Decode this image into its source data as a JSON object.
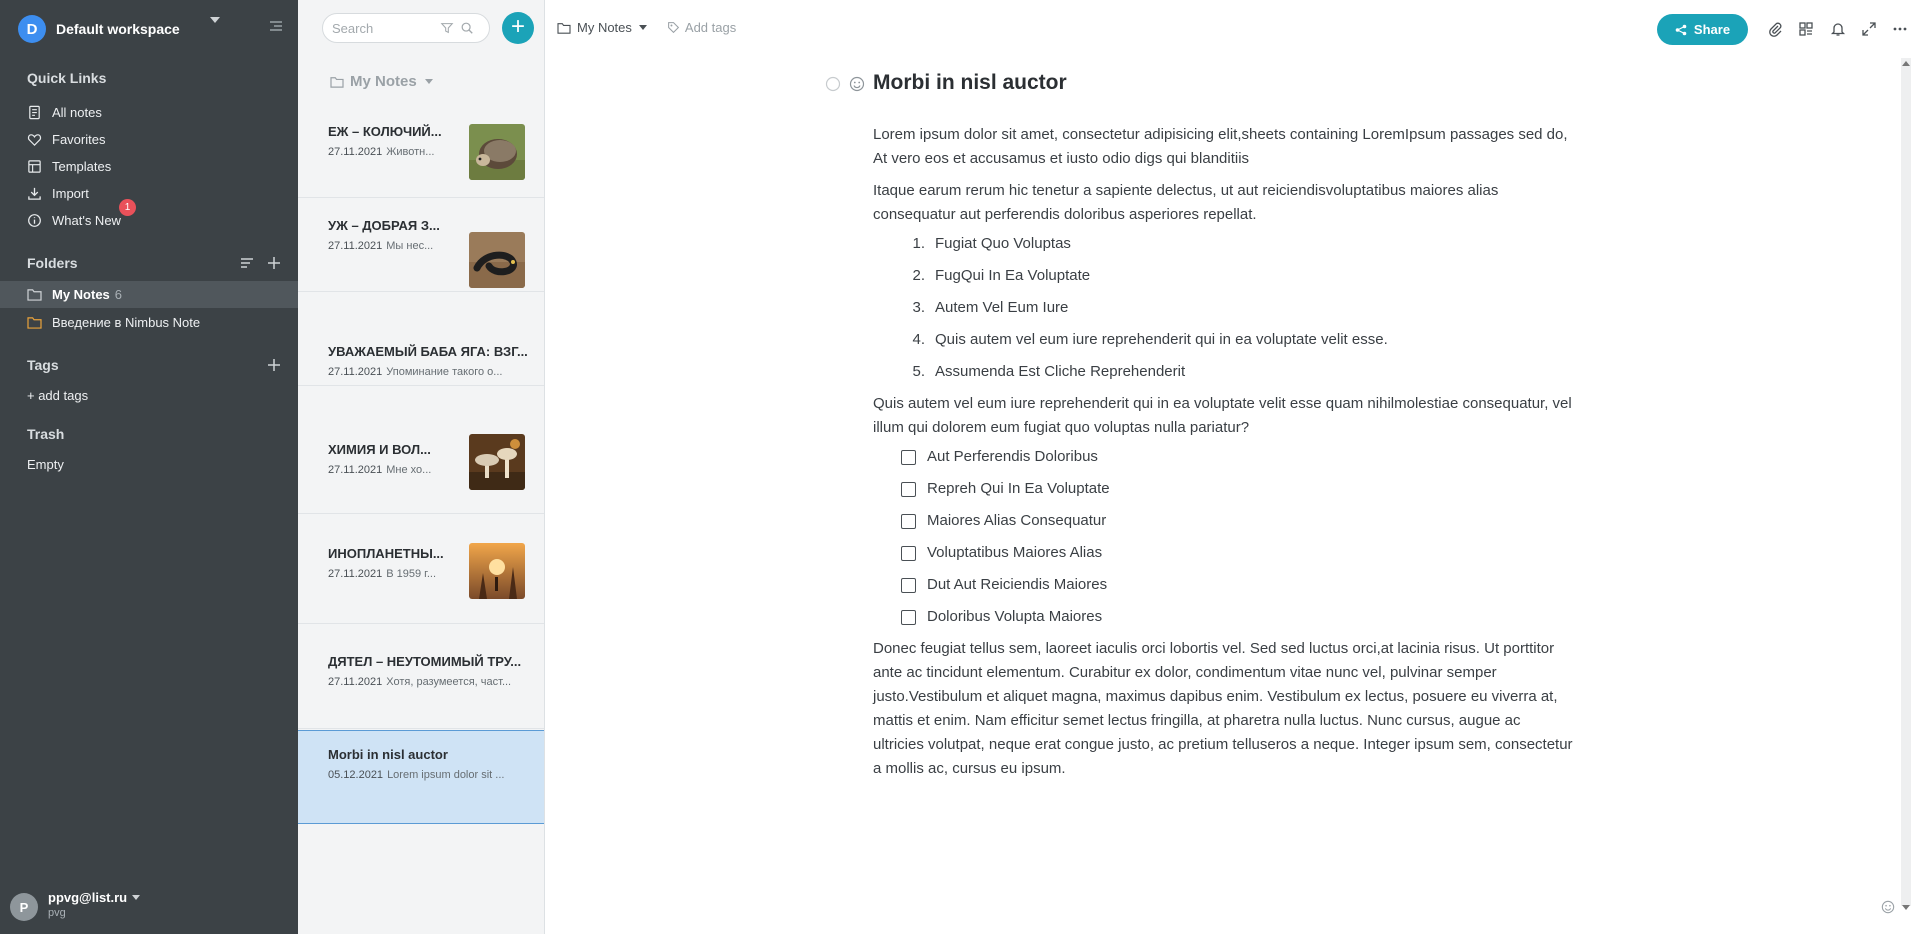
{
  "workspace": {
    "avatar": "D",
    "name": "Default workspace"
  },
  "quick_links": {
    "title": "Quick Links",
    "items": [
      {
        "label": "All notes",
        "icon": "notes-icon"
      },
      {
        "label": "Favorites",
        "icon": "heart-icon"
      },
      {
        "label": "Templates",
        "icon": "template-icon"
      },
      {
        "label": "Import",
        "icon": "download-icon"
      },
      {
        "label": "What's New",
        "icon": "info-icon",
        "badge": "1"
      }
    ]
  },
  "folders": {
    "title": "Folders",
    "items": [
      {
        "label": "My Notes",
        "count": "6",
        "active": true,
        "color": "#cfd3d6"
      },
      {
        "label": "Введение в Nimbus Note",
        "count": "",
        "active": false,
        "color": "#e9a23b"
      }
    ]
  },
  "tags": {
    "title": "Tags",
    "add_label": "+ add tags"
  },
  "trash": {
    "title": "Trash",
    "status": "Empty"
  },
  "user": {
    "avatar": "P",
    "email": "ppvg@list.ru",
    "name": "pvg"
  },
  "search": {
    "placeholder": "Search"
  },
  "list": {
    "folder": "My Notes",
    "notes": [
      {
        "title": "ЕЖ – КОЛЮЧИЙ...",
        "date": "27.11.2021",
        "preview": "Животн...",
        "thumb": "hedgehog"
      },
      {
        "title": "УЖ – ДОБРАЯ З...",
        "date": "27.11.2021",
        "preview": "Мы нес...",
        "thumb": "snake"
      },
      {
        "title": "УВАЖАЕМЫЙ БАБА ЯГА: ВЗГ...",
        "date": "27.11.2021",
        "preview": "Упоминание такого о...",
        "thumb": ""
      },
      {
        "title": "ХИМИЯ И ВОЛ...",
        "date": "27.11.2021",
        "preview": "Мне хо...",
        "thumb": "mushrooms"
      },
      {
        "title": "ИНОПЛАНЕТНЫ...",
        "date": "27.11.2021",
        "preview": "В 1959 г...",
        "thumb": "sunset"
      },
      {
        "title": "ДЯТЕЛ – НЕУТОМИМЫЙ ТРУ...",
        "date": "27.11.2021",
        "preview": "Хотя, разумеется, част...",
        "thumb": ""
      },
      {
        "title": "Morbi in nisl auctor",
        "date": "05.12.2021",
        "preview": "Lorem ipsum dolor sit ...",
        "thumb": "",
        "active": true
      }
    ]
  },
  "editor": {
    "breadcrumb": "My Notes",
    "add_tags": "Add tags",
    "share": "Share",
    "title": "Morbi in nisl auctor",
    "p1": "Lorem ipsum dolor sit amet, consectetur adipisicing elit,sheets containing LoremIpsum passages sed do, At vero eos et accusamus et iusto odio digs qui blanditiis",
    "p2": "Itaque earum rerum hic tenetur a sapiente delectus, ut aut reiciendisvoluptatibus maiores alias consequatur aut perferendis doloribus asperiores repellat.",
    "ordered": [
      "Fugiat Quo Voluptas",
      "FugQui In Ea Voluptate",
      "Autem Vel Eum Iure",
      "Quis autem vel eum iure reprehenderit qui in ea voluptate velit esse.",
      "Assumenda Est Cliche Reprehenderit"
    ],
    "p3": "Quis autem vel eum iure reprehenderit qui in ea voluptate velit esse quam nihilmolestiae consequatur, vel illum qui dolorem eum fugiat quo voluptas nulla pariatur?",
    "checklist": [
      "Aut Perferendis Doloribus",
      "Repreh Qui In Ea Voluptate",
      "Maiores Alias Consequatur",
      "Voluptatibus Maiores Alias",
      "Dut Aut Reiciendis Maiores",
      "Doloribus Volupta Maiores"
    ],
    "p4": "Donec feugiat tellus sem, laoreet iaculis orci lobortis vel. Sed sed luctus orci,at lacinia risus. Ut porttitor ante ac tincidunt elementum. Curabitur ex dolor, condimentum vitae nunc vel, pulvinar semper justo.Vestibulum et aliquet magna, maximus dapibus enim. Vestibulum ex lectus, posuere eu viverra at, mattis et enim. Nam efficitur semet lectus fringilla, at pharetra nulla luctus. Nunc cursus, augue ac ultricies volutpat, neque erat congue justo, ac pretium telluseros a neque. Integer ipsum sem, consectetur a mollis ac, cursus eu ipsum."
  },
  "colors": {
    "accent": "#1ba3b8",
    "sidebar": "#3c4246",
    "badge": "#e9515a",
    "selected_note": "#cfe3f5"
  }
}
